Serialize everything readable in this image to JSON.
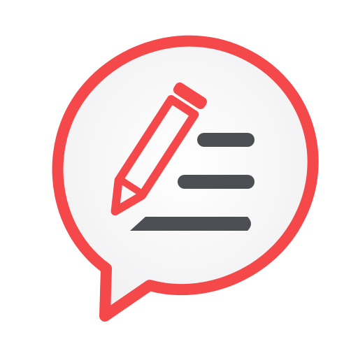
{
  "icon": {
    "name": "note-chat-bubble-app-icon",
    "parts": [
      "speech-bubble-icon",
      "pencil-icon",
      "text-lines-icon"
    ]
  },
  "colors": {
    "background": "#ffffff",
    "bubble_fill": "#f5f5f6",
    "accent_red": "#f5484a",
    "line_dark": "#4b4e53"
  }
}
